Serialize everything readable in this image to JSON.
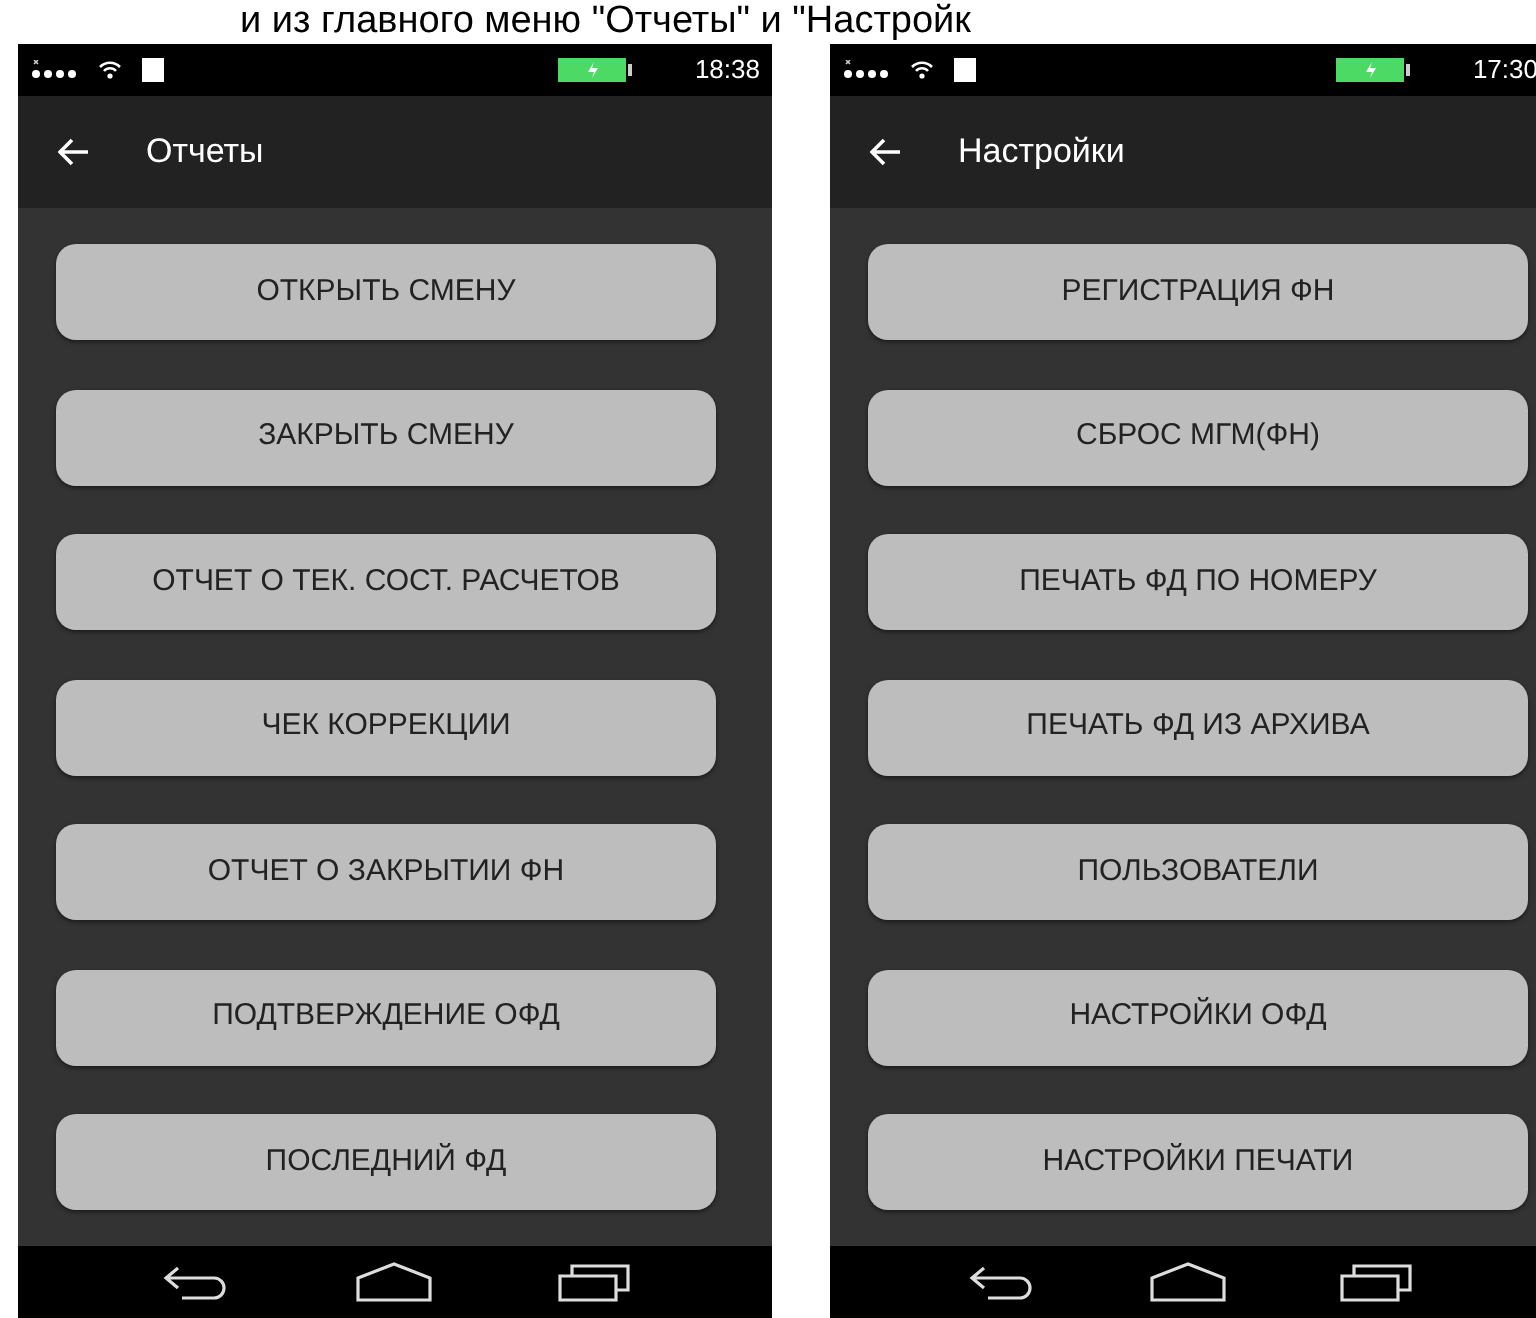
{
  "caption": "и из главного меню \"Отчеты\" и \"Настройк",
  "screens": [
    {
      "status_bar": {
        "time": "18:38"
      },
      "title": "Отчеты",
      "buttons": [
        "ОТКРЫТЬ СМЕНУ",
        "ЗАКРЫТЬ СМЕНУ",
        "ОТЧЕТ О ТЕК. СОСТ. РАСЧЕТОВ",
        "ЧЕК КОРРЕКЦИИ",
        "ОТЧЕТ О ЗАКРЫТИИ ФН",
        "ПОДТВЕРЖДЕНИЕ ОФД",
        "ПОСЛЕДНИЙ ФД"
      ]
    },
    {
      "status_bar": {
        "time": "17:30"
      },
      "title": "Настройки",
      "buttons": [
        "РЕГИСТРАЦИЯ ФН",
        "СБРОС МГМ(ФН)",
        "ПЕЧАТЬ ФД ПО НОМЕРУ",
        "ПЕЧАТЬ ФД ИЗ АРХИВА",
        "ПОЛЬЗОВАТЕЛИ",
        "НАСТРОЙКИ ОФД",
        "НАСТРОЙКИ ПЕЧАТИ"
      ]
    }
  ]
}
